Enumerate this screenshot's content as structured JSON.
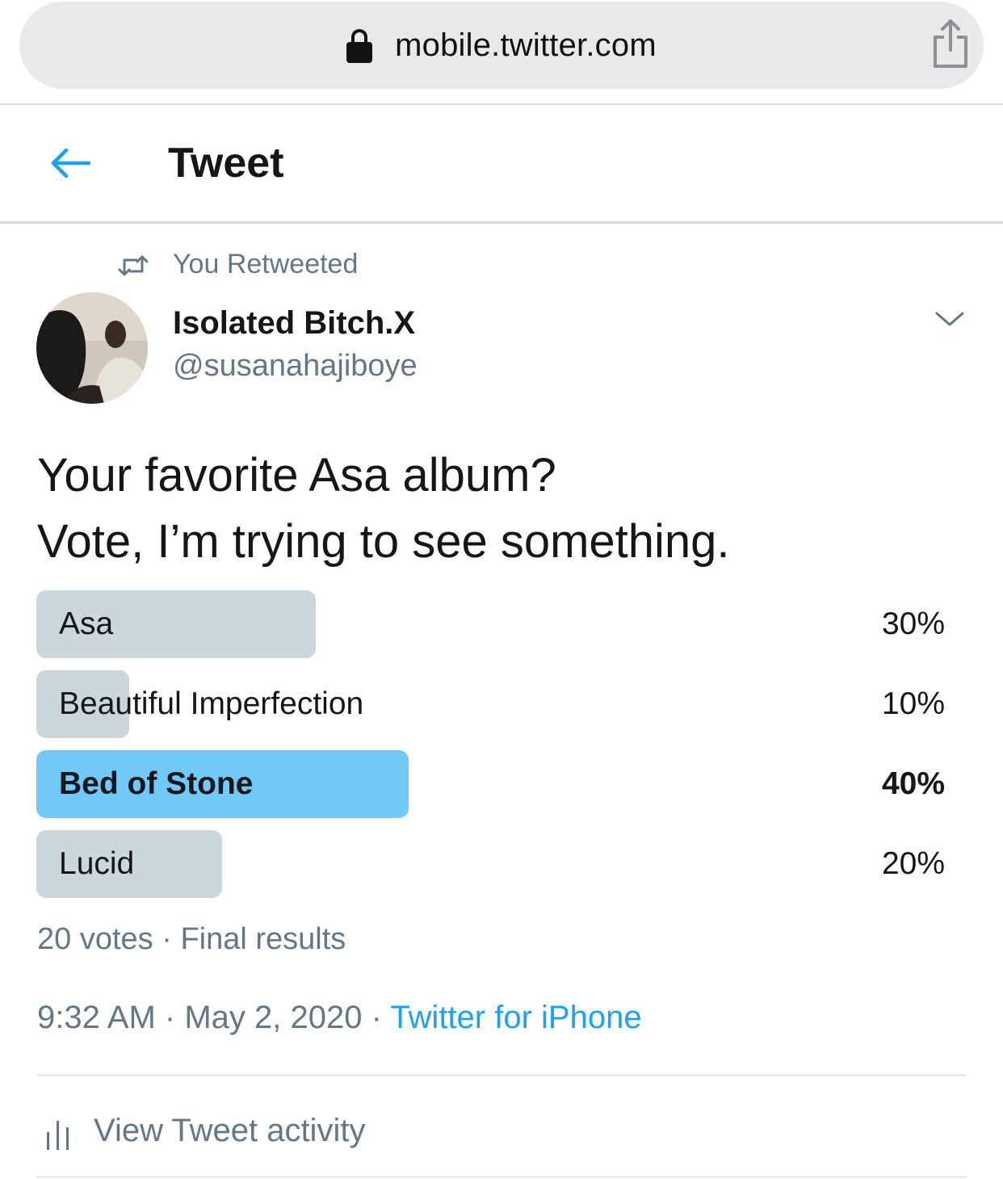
{
  "browser": {
    "url": "mobile.twitter.com",
    "icons": {
      "lock": "lock-icon",
      "share": "share-icon"
    }
  },
  "header": {
    "title": "Tweet",
    "back_icon": "back-arrow-icon",
    "accent_color": "#1da1f2"
  },
  "tweet": {
    "retweet_label": "You Retweeted",
    "author": {
      "name": "Isolated Bitch.X",
      "handle": "@susanahajiboye"
    },
    "text_lines": [
      "Your favorite Asa album?",
      "Vote, I’m trying to see something."
    ],
    "poll": {
      "options": [
        {
          "label": "Asa",
          "percent_text": "30%",
          "value": 30,
          "winner": false
        },
        {
          "label": "Beautiful Imperfection",
          "percent_text": "10%",
          "value": 10,
          "winner": false
        },
        {
          "label": "Bed of Stone",
          "percent_text": "40%",
          "value": 40,
          "winner": true
        },
        {
          "label": "Lucid",
          "percent_text": "20%",
          "value": 20,
          "winner": false
        }
      ],
      "votes": "20 votes",
      "status": "Final results",
      "bar_color": "#ccd6dd",
      "winner_color": "#71c9f8"
    },
    "time": "9:32 AM",
    "date": "May 2, 2020",
    "source": "Twitter for iPhone"
  },
  "activity": {
    "label": "View Tweet activity"
  }
}
